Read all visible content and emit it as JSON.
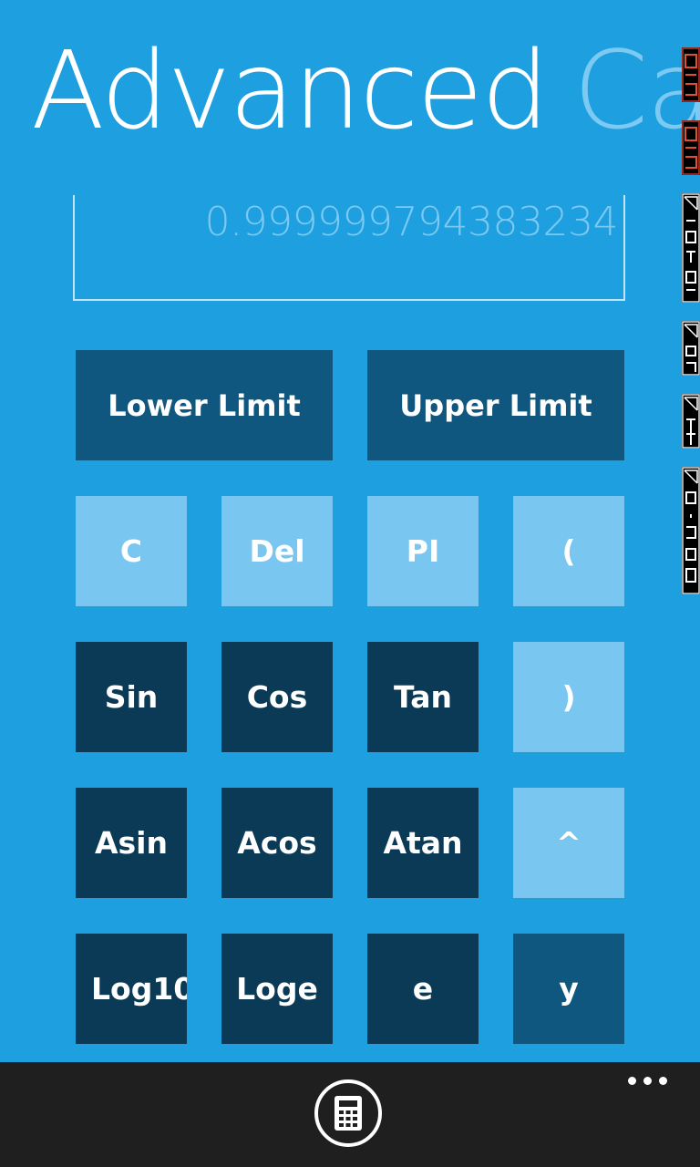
{
  "title": {
    "main": "Advanced",
    "rest": "Calc"
  },
  "display": {
    "value": "0.999999794383234"
  },
  "limits": {
    "lower": "Lower Limit",
    "upper": "Upper Limit"
  },
  "keys": {
    "row1": [
      "C",
      "Del",
      "PI",
      "("
    ],
    "row2": [
      "Sin",
      "Cos",
      "Tan",
      ")"
    ],
    "row3": [
      "Asin",
      "Acos",
      "Atan",
      "^"
    ],
    "row4": [
      "Log10",
      "Loge",
      "e",
      "y"
    ]
  },
  "appbar": {
    "button_icon": "calculator-icon",
    "more_icon": "ellipsis-icon"
  },
  "colors": {
    "background": "#1d9fe0",
    "key_light": "#79c6f0",
    "key_dark": "#0b3a57",
    "key_mid": "#0f577f",
    "appbar": "#1f1f1f"
  }
}
